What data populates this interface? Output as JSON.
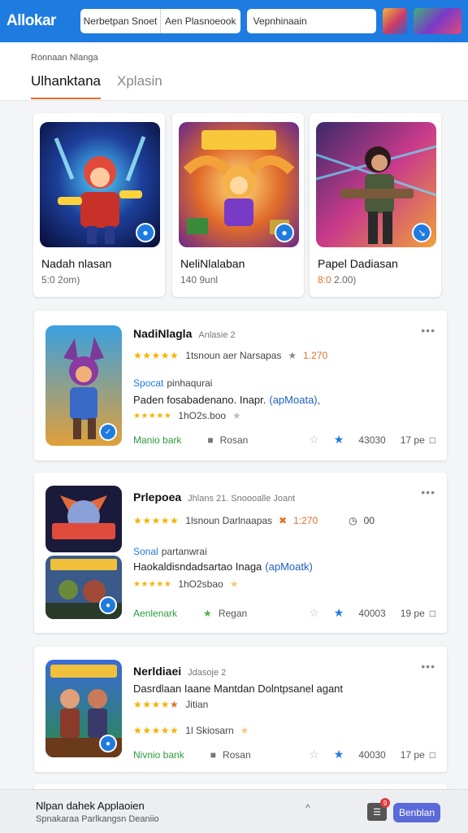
{
  "topbar": {
    "logo": "Allokar",
    "box_left": "Nerbetpan Snoet",
    "box_right": "Aen Plasnoeook",
    "search_value": "Vepnhinaain",
    "thumb_icons": [
      "game-thumb-icon",
      "game-thumb-group-icon"
    ]
  },
  "header": {
    "breadcrumb": "Ronnaan Nlanga",
    "tabs": [
      {
        "label": "Ulhanktana",
        "active": true
      },
      {
        "label": "Xplasin",
        "active": false
      }
    ]
  },
  "featured": [
    {
      "name": "Nadah nlasan",
      "sub": "5:0 2om)"
    },
    {
      "name": "NeliNlalaban",
      "sub": "140 9unl"
    },
    {
      "name": "Papel Dadiasan",
      "sub_accent": "8:0",
      "sub": "2.00)"
    }
  ],
  "apps": [
    {
      "title": "NadiNlagla",
      "meta": "Anlasie 2",
      "rating_text": "1tsnoun aer Narsapas",
      "rating_value": "1.270",
      "category": "Spocat",
      "category_rest": "pinhaqurai",
      "desc": "Paden fosabadenano. Inapr.",
      "desc_link": "(apMoata),",
      "sub_stars_text": "1hO2s.boo",
      "footer_left": "Manio bark",
      "footer_mid": "Rosan",
      "footer_num": "43030",
      "footer_right": "17 pe"
    },
    {
      "title": "Prlepoea",
      "meta": "Jhlans 21. Snoooalle Joant",
      "rating_text": "1lsnoun Darlnaapas",
      "rating_value": "1:270",
      "extra": "00",
      "category": "Sonal",
      "category_rest": "partanwrai",
      "desc": "Haokaldisndadsartao Inaga",
      "desc_link": "(apMoatk)",
      "sub_stars_text": "1hO2sbao",
      "footer_left": "Aenlenark",
      "footer_mid": "Regan",
      "footer_num": "40003",
      "footer_right": "19 pe"
    },
    {
      "title": "Nerldiaei",
      "meta": "Jdasoje 2",
      "desc": "Dasrdlaan Iaane Mantdan Dolntpsanel agant",
      "sub_stars_text": "Jitian",
      "rating_text": "1l Skiosarn",
      "footer_left": "Nivnio bank",
      "footer_mid": "Rosan",
      "footer_num": "40030",
      "footer_right": "17 pe"
    }
  ],
  "bottombar": {
    "title": "Nlpan dahek Applaoien",
    "subtitle": "Spnakaraa Parlkangsn Deaniio",
    "cart_count": "9",
    "button_label": "Benblan"
  },
  "colors": {
    "primary": "#1e7be0",
    "accent": "#e0702a",
    "star": "#f5b300",
    "green": "#2d9c3c"
  }
}
